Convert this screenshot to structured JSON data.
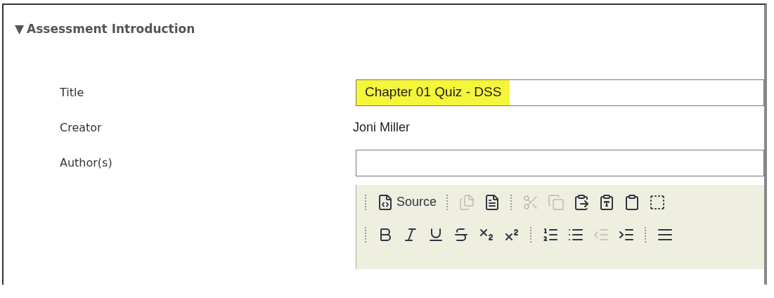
{
  "section": {
    "toggle": "▼",
    "title": "Assessment Introduction",
    "expanded": true
  },
  "fields": [
    {
      "kind": "input",
      "label": "Title",
      "value": "Chapter 01 Quiz - DSS",
      "highlighted": true
    },
    {
      "kind": "text",
      "label": "Creator",
      "value": "Joni Miller"
    },
    {
      "kind": "input",
      "label": "Author(s)"
    }
  ],
  "toolbar": {
    "rows": [
      [
        {
          "kind": "source",
          "label": "Source",
          "disabled": false
        },
        {
          "kind": "sep"
        },
        {
          "kind": "newpage",
          "disabled": true
        },
        {
          "kind": "template",
          "disabled": false
        },
        {
          "kind": "sep"
        },
        {
          "kind": "cut",
          "disabled": true
        },
        {
          "kind": "copy",
          "disabled": true
        },
        {
          "kind": "paste",
          "disabled": false
        },
        {
          "kind": "pastetext",
          "disabled": false
        },
        {
          "kind": "pasteword",
          "disabled": false
        },
        {
          "kind": "selectall",
          "disabled": false
        }
      ],
      [
        {
          "kind": "bold",
          "disabled": false
        },
        {
          "kind": "italic",
          "disabled": false
        },
        {
          "kind": "underline",
          "disabled": false
        },
        {
          "kind": "strike",
          "disabled": false
        },
        {
          "kind": "subscript",
          "disabled": false
        },
        {
          "kind": "superscript",
          "disabled": false
        },
        {
          "kind": "sep"
        },
        {
          "kind": "orderedlist",
          "disabled": false
        },
        {
          "kind": "bulletlist",
          "disabled": false
        },
        {
          "kind": "outdent",
          "disabled": true
        },
        {
          "kind": "indent",
          "disabled": false
        },
        {
          "kind": "sep"
        },
        {
          "kind": "align",
          "disabled": false
        }
      ]
    ]
  }
}
